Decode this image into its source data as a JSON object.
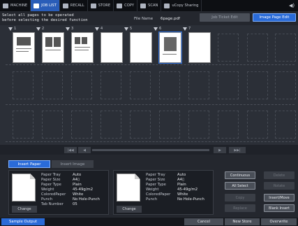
{
  "topbar": {
    "tabs": [
      {
        "label": "MACHINE",
        "icon": "machine-icon"
      },
      {
        "label": "JOB LIST",
        "icon": "joblist-icon",
        "active": true
      },
      {
        "label": "RECALL",
        "icon": "recall-icon"
      },
      {
        "label": "STORE",
        "icon": "store-icon"
      },
      {
        "label": "COPY",
        "icon": "copy-icon"
      },
      {
        "label": "SCAN",
        "icon": "scan-icon"
      },
      {
        "label": "uCopy Sharing",
        "icon": "share-icon"
      }
    ],
    "speaker_icon": "speaker-icon"
  },
  "header": {
    "message_line1": "Select all pages to be operated",
    "message_line2": "before selecting the desired function",
    "file_name_label": "File Name",
    "file_name": "6page.pdf",
    "job_ticket_edit": "Job Ticket Edit",
    "image_page_edit": "Image Page Edit"
  },
  "pages": {
    "numbers": [
      "1",
      "2",
      "3",
      "4",
      "5",
      "6",
      "7"
    ],
    "selected": "6"
  },
  "scroller": {
    "first_label": "|◀◀",
    "prev_label": "◀",
    "next_label": "▶",
    "last_label": "▶▶|"
  },
  "tabs": {
    "insert_paper": "Insert Paper",
    "insert_image": "Insert Image"
  },
  "left_card": {
    "change_label": "Change",
    "rows": [
      {
        "k": "Paper Tray",
        "v": "Auto"
      },
      {
        "k": "Paper Size",
        "v": "A4▯"
      },
      {
        "k": "Paper Type",
        "v": "Plain"
      },
      {
        "k": "Weight",
        "v": "45-49g/m2"
      },
      {
        "k": "ColoredPaper",
        "v": "White"
      },
      {
        "k": "Punch",
        "v": "No Hole-Punch"
      },
      {
        "k": "Tab Number",
        "v": "05"
      }
    ]
  },
  "right_card": {
    "change_label": "Change",
    "rows": [
      {
        "k": "Paper Tray",
        "v": "Auto"
      },
      {
        "k": "Paper Size",
        "v": "A4▯"
      },
      {
        "k": "",
        "v": ""
      },
      {
        "k": "Paper Type",
        "v": "Plain"
      },
      {
        "k": "Weight",
        "v": "45-49g/m2"
      },
      {
        "k": "ColoredPaper",
        "v": "White"
      },
      {
        "k": "Punch",
        "v": "No Hole-Punch"
      }
    ]
  },
  "actions": {
    "continuous": "Continuous",
    "all_select": "All Select",
    "copy": "Copy",
    "replace": "Replace",
    "delete": "Delete",
    "rotate": "Rotate",
    "insert_move": "Insert/Move",
    "blank_insert": "Blank Insert"
  },
  "footer": {
    "sample_output": "Sample Output",
    "cancel": "Cancel",
    "new_store": "New Store",
    "overwrite": "Overwrite"
  }
}
